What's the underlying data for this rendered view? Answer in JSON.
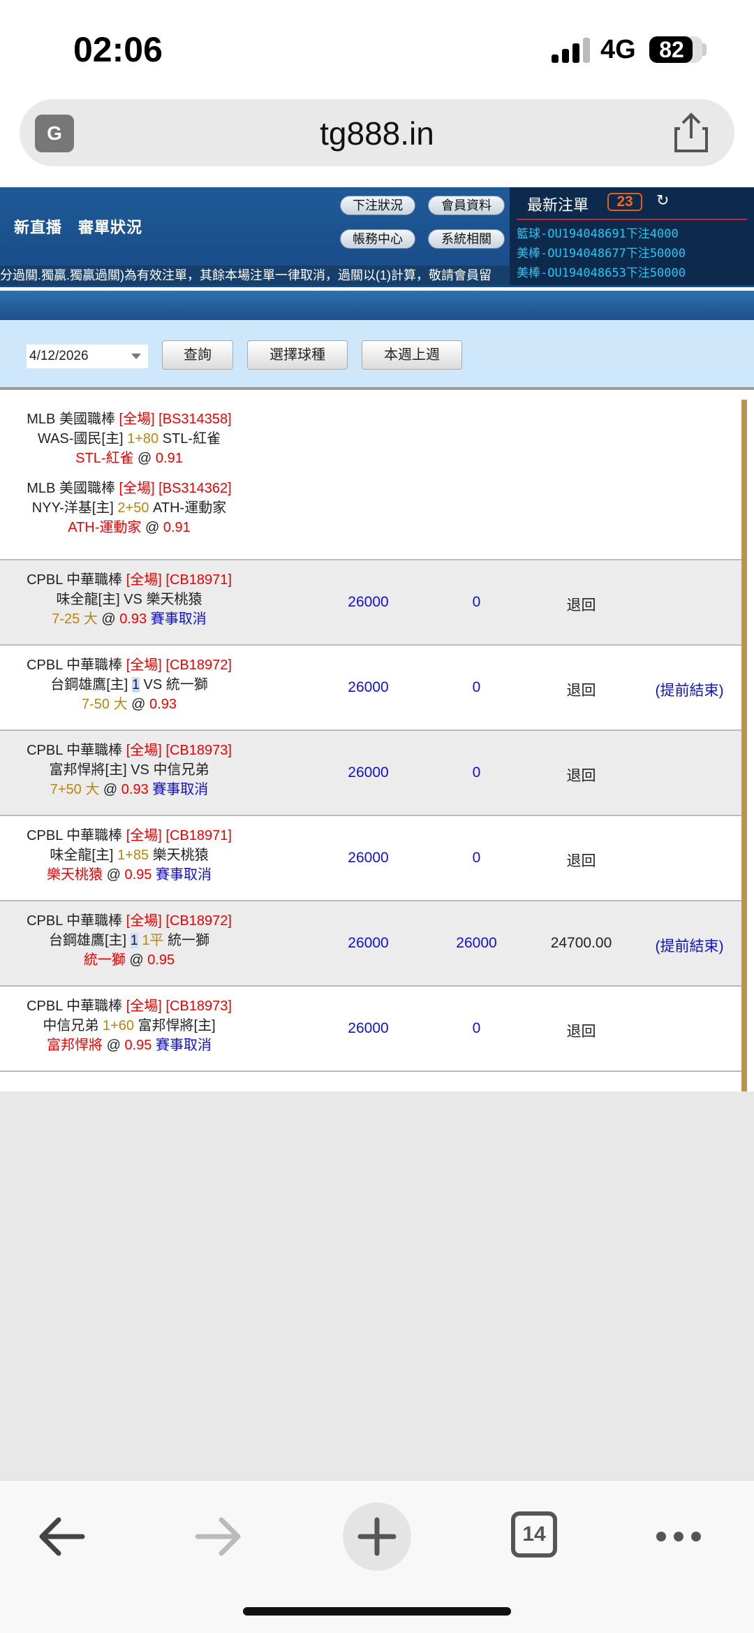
{
  "status": {
    "time": "02:06",
    "network": "4G",
    "battery": "82",
    "battery_level": 0.82
  },
  "browser": {
    "url": "tg888.in",
    "tabs_count": "14"
  },
  "header": {
    "nav_left": "新直播　審單狀況",
    "buttons": {
      "bet_status": "下注狀況",
      "member_info": "會員資料",
      "account_center": "帳務中心",
      "system": "系統相關"
    },
    "ticker": "分過關.獨贏.獨贏過關)為有效注單，其餘本場注單一律取消，過關以(1)計算，敬請會員留"
  },
  "newest_bets": {
    "title": "最新注單",
    "count": "23",
    "lines": [
      "籃球-OU194048691下注4000",
      "美棒-OU194048677下注50000",
      "美棒-OU194048653下注50000"
    ]
  },
  "filter": {
    "date": "4/12/2026",
    "query": "查詢",
    "choose_sport": "選擇球種",
    "this_last_week": "本週上週"
  },
  "top_bets": [
    {
      "league": "MLB 美國職棒",
      "tag": "[全場] [BS314358]",
      "home": "WAS-國民[主]",
      "line": "1+80",
      "away": "STL-紅雀",
      "pick": "STL-紅雀",
      "odds": "0.91"
    },
    {
      "league": "MLB 美國職棒",
      "tag": "[全場] [BS314362]",
      "home": "NYY-洋基[主]",
      "line": "2+50",
      "away": "ATH-運動家",
      "pick": "ATH-運動家",
      "odds": "0.91"
    }
  ],
  "rows": [
    {
      "league": "CPBL 中華職棒",
      "tag": "[全場] [CB18971]",
      "l2a": "味全龍[主] VS 樂天桃猿",
      "l2b": "",
      "l2c": "",
      "l2d": "",
      "pick_gold": "7-25 大",
      "pick_red": "",
      "odds": "0.93",
      "note": "賽事取消",
      "stake": "26000",
      "valid": "0",
      "result": "退回",
      "extra": ""
    },
    {
      "league": "CPBL 中華職棒",
      "tag": "[全場] [CB18972]",
      "l2a": "台鋼雄鷹[主] ",
      "l2b": "1",
      "l2c": " VS 統一獅",
      "l2d": "",
      "pick_gold": "7-50 大",
      "pick_red": "",
      "odds": "0.93",
      "note": "",
      "stake": "26000",
      "valid": "0",
      "result": "退回",
      "extra": "(提前結束)"
    },
    {
      "league": "CPBL 中華職棒",
      "tag": "[全場] [CB18973]",
      "l2a": "富邦悍將[主] VS 中信兄弟",
      "l2b": "",
      "l2c": "",
      "l2d": "",
      "pick_gold": "7+50 大",
      "pick_red": "",
      "odds": "0.93",
      "note": "賽事取消",
      "stake": "26000",
      "valid": "0",
      "result": "退回",
      "extra": ""
    },
    {
      "league": "CPBL 中華職棒",
      "tag": "[全場] [CB18971]",
      "l2a": "味全龍[主] ",
      "l2b": "",
      "l2c": "1+85",
      "l2d": " 樂天桃猿",
      "pick_gold": "",
      "pick_red": "樂天桃猿",
      "odds": "0.95",
      "note": "賽事取消",
      "stake": "26000",
      "valid": "0",
      "result": "退回",
      "extra": ""
    },
    {
      "league": "CPBL 中華職棒",
      "tag": "[全場] [CB18972]",
      "l2a": "台鋼雄鷹[主] ",
      "l2b": "1",
      "l2c": " 1平",
      "l2d": " 統一獅",
      "pick_gold": "",
      "pick_red": "統一獅",
      "odds": "0.95",
      "note": "",
      "stake": "26000",
      "valid": "26000",
      "result": "24700.00",
      "extra": "(提前結束)"
    },
    {
      "league": "CPBL 中華職棒",
      "tag": "[全場] [CB18973]",
      "l2a": "中信兄弟 ",
      "l2b": "",
      "l2c": "1+60",
      "l2d": " 富邦悍將[主]",
      "pick_gold": "",
      "pick_red": "富邦悍將",
      "odds": "0.95",
      "note": "賽事取消",
      "stake": "26000",
      "valid": "0",
      "result": "退回",
      "extra": ""
    }
  ],
  "colors": {
    "header_blue": "#1f5a98",
    "filter_bg": "#cfe7fb",
    "accent_red": "#e00000",
    "gold": "#b8860b",
    "link_blue": "#1010d0"
  }
}
